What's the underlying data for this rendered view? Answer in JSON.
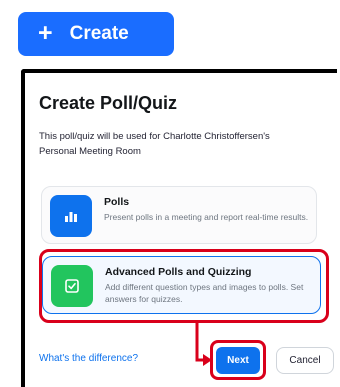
{
  "create_button": {
    "icon": "plus-icon",
    "label": "Create"
  },
  "dialog": {
    "title": "Create Poll/Quiz",
    "description": "This poll/quiz will be used for Charlotte Christoffersen's Personal Meeting Room",
    "options": [
      {
        "title": "Polls",
        "description": "Present polls in a meeting and report real-time results.",
        "icon": "bar-chart-icon",
        "icon_color": "#0e72ed"
      },
      {
        "title": "Advanced Polls and Quizzing",
        "description": "Add different question types and images to polls. Set answers for quizzes.",
        "icon": "quiz-check-icon",
        "icon_color": "#22c55e",
        "selected": true
      }
    ],
    "difference_link": "What's the difference?",
    "next_label": "Next",
    "cancel_label": "Cancel"
  },
  "colors": {
    "accent": "#0e72ed",
    "create_button": "#1a6dff",
    "annotation": "#d9001b"
  }
}
